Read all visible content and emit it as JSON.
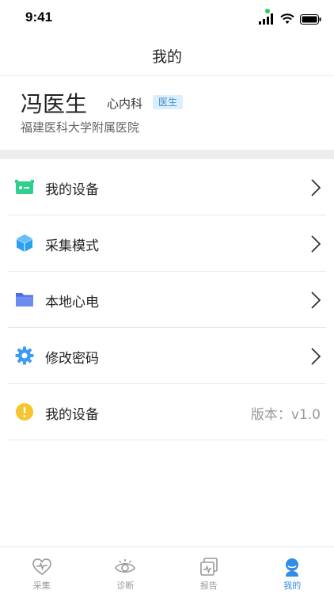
{
  "status_bar": {
    "time": "9:41"
  },
  "nav": {
    "title": "我的"
  },
  "profile": {
    "name": "冯医生",
    "department": "心内科",
    "badge": "医生",
    "hospital": "福建医科大学附属医院"
  },
  "menu": {
    "items": [
      {
        "label": "我的设备",
        "icon": "device-icon",
        "chevron": true
      },
      {
        "label": "采集模式",
        "icon": "cube-icon",
        "chevron": true
      },
      {
        "label": "本地心电",
        "icon": "folder-icon",
        "chevron": true
      },
      {
        "label": "修改密码",
        "icon": "gear-icon",
        "chevron": true
      },
      {
        "label": "我的设备",
        "icon": "info-icon",
        "chevron": false,
        "value": "版本：v1.0"
      }
    ]
  },
  "tabs": [
    {
      "label": "采集",
      "icon": "heart-pulse-icon",
      "active": false
    },
    {
      "label": "诊断",
      "icon": "eye-icon",
      "active": false
    },
    {
      "label": "报告",
      "icon": "report-icon",
      "active": false
    },
    {
      "label": "我的",
      "icon": "user-icon",
      "active": true
    }
  ],
  "colors": {
    "accent": "#2f8de4",
    "device_icon": "#2ecf8f",
    "cube_icon": "#2aa0f0",
    "folder_icon": "#4a6de6",
    "gear_icon": "#3f9af5",
    "info_icon": "#f7c52b",
    "badge_bg": "#ddeefb"
  }
}
